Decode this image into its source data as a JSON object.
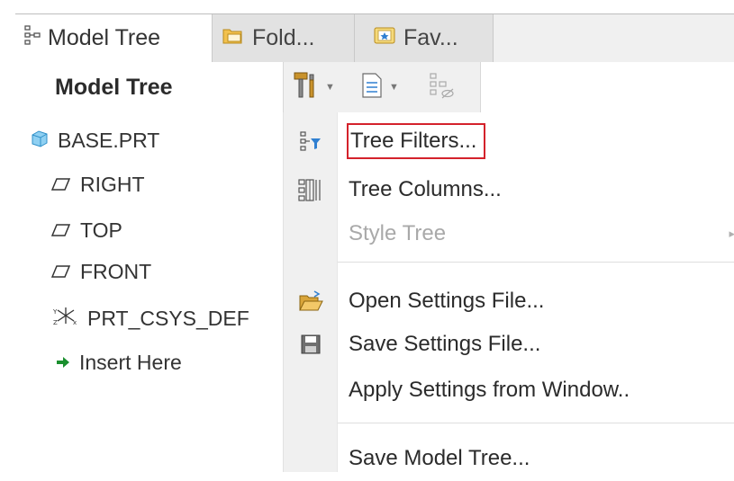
{
  "tabs": [
    {
      "label": "Model Tree",
      "icon": "model-tree-icon"
    },
    {
      "label": "Fold...",
      "icon": "folder-browser-icon"
    },
    {
      "label": "Fav...",
      "icon": "favorites-icon"
    }
  ],
  "header": {
    "title": "Model Tree"
  },
  "toolbar": {
    "settings_icon": "settings-tools-icon",
    "show_icon": "show-list-icon",
    "visibility_icon": "visibility-icon"
  },
  "tree": {
    "items": [
      {
        "label": "BASE.PRT",
        "icon": "part-icon"
      },
      {
        "label": "RIGHT",
        "icon": "datum-plane-icon"
      },
      {
        "label": "TOP",
        "icon": "datum-plane-icon"
      },
      {
        "label": "FRONT",
        "icon": "datum-plane-icon"
      },
      {
        "label": "PRT_CSYS_DEF",
        "icon": "coordinate-system-icon"
      },
      {
        "label": "Insert Here",
        "icon": "insert-arrow-icon"
      }
    ]
  },
  "menu": {
    "items": [
      {
        "label": "Tree Filters...",
        "icon": "tree-filter-icon",
        "highlighted": true
      },
      {
        "label": "Tree Columns...",
        "icon": "tree-columns-icon"
      },
      {
        "label": "Style Tree",
        "disabled": true,
        "submenu": true
      },
      {
        "label": "Open Settings File...",
        "icon": "open-folder-icon"
      },
      {
        "label": "Save Settings File...",
        "icon": "save-disk-icon"
      },
      {
        "label": "Apply Settings from Window.."
      },
      {
        "label": "Save Model Tree..."
      }
    ]
  },
  "colors": {
    "highlight_border": "#d4222b",
    "gutter": "#f0f0f0",
    "disabled_text": "#a9a9a9",
    "insert_arrow": "#1a8f2e",
    "part_blue": "#5fb3e6"
  }
}
